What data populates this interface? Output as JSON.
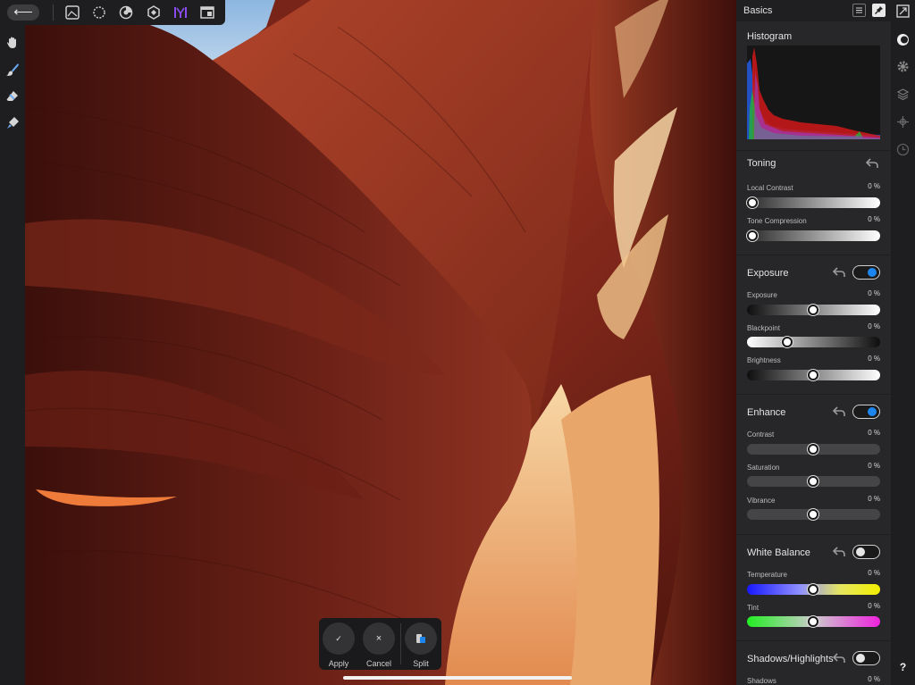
{
  "app": {
    "back_glyph": "⟵",
    "personas": [
      {
        "name": "photo-persona-icon"
      },
      {
        "name": "liquify-persona-icon"
      },
      {
        "name": "develop-persona-icon"
      },
      {
        "name": "tone-mapping-persona-icon"
      },
      {
        "name": "export-persona-icon",
        "active": true,
        "accent": "#8a4cf0"
      },
      {
        "name": "view-mode-icon"
      }
    ]
  },
  "left_tools": [
    "view-hand-icon",
    "brush-icon",
    "eraser-icon",
    "clone-icon"
  ],
  "panel": {
    "title": "Basics",
    "histogram": {
      "title": "Histogram"
    },
    "sections": {
      "toning": {
        "title": "Toning",
        "sliders": [
          {
            "label": "Local Contrast",
            "value": "0 %"
          },
          {
            "label": "Tone Compression",
            "value": "0 %"
          }
        ]
      },
      "exposure": {
        "title": "Exposure",
        "enabled": true,
        "sliders": [
          {
            "label": "Exposure",
            "value": "0 %"
          },
          {
            "label": "Blackpoint",
            "value": "0 %"
          },
          {
            "label": "Brightness",
            "value": "0 %"
          }
        ]
      },
      "enhance": {
        "title": "Enhance",
        "enabled": true,
        "sliders": [
          {
            "label": "Contrast",
            "value": "0 %"
          },
          {
            "label": "Saturation",
            "value": "0 %"
          },
          {
            "label": "Vibrance",
            "value": "0 %"
          }
        ]
      },
      "white_balance": {
        "title": "White Balance",
        "enabled": false,
        "sliders": [
          {
            "label": "Temperature",
            "value": "0 %"
          },
          {
            "label": "Tint",
            "value": "0 %"
          }
        ]
      },
      "shadows_highlights": {
        "title": "Shadows/Highlights",
        "enabled": false,
        "sliders": [
          {
            "label": "Shadows",
            "value": "0 %"
          }
        ]
      }
    }
  },
  "studio_tools": [
    "tone-studio-icon",
    "settings-gear-icon",
    "layers-icon",
    "transform-icon",
    "history-icon"
  ],
  "help_label": "?",
  "context": {
    "apply_label": "Apply",
    "cancel_label": "Cancel",
    "split_label": "Split",
    "apply_glyph": "✓",
    "cancel_glyph": "×"
  },
  "colors": {
    "accent_blue": "#1d86ee",
    "persona_active": "#8a4cf0"
  }
}
